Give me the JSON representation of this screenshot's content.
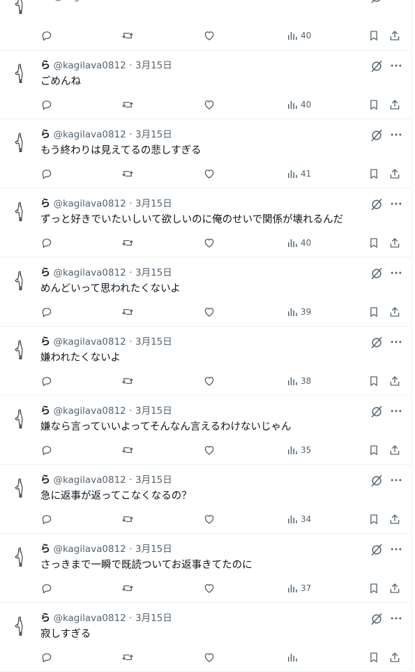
{
  "user": {
    "display_name": "ら",
    "handle": "@kagilava0812",
    "separator": "·",
    "date": "3月15日"
  },
  "icons": {
    "reply": "reply-icon",
    "retweet": "retweet-icon",
    "like": "heart-icon",
    "views": "views-icon",
    "bookmark": "bookmark-icon",
    "share": "share-icon",
    "grok": "grok-icon",
    "more": "more-icon"
  },
  "colors": {
    "muted": "#536471",
    "text": "#0f1419",
    "divider": "#eff3f4"
  },
  "tweets": [
    {
      "text": "",
      "views": "40"
    },
    {
      "text": "ごめんね",
      "views": "40"
    },
    {
      "text": "もう終わりは見えてるの悲しすぎる",
      "views": "41"
    },
    {
      "text": "ずっと好きでいたいしいて欲しいのに俺のせいで関係が壊れるんだ",
      "views": "40"
    },
    {
      "text": "めんどいって思われたくないよ",
      "views": "39"
    },
    {
      "text": "嫌われたくないよ",
      "views": "38"
    },
    {
      "text": "嫌なら言っていいよってそんなん言えるわけないじゃん",
      "views": "35"
    },
    {
      "text": "急に返事が返ってこなくなるの？",
      "views": "34"
    },
    {
      "text": "さっきまで一瞬で既読ついてお返事きてたのに",
      "views": "37"
    },
    {
      "text": "寂しすぎる",
      "views": ""
    }
  ]
}
